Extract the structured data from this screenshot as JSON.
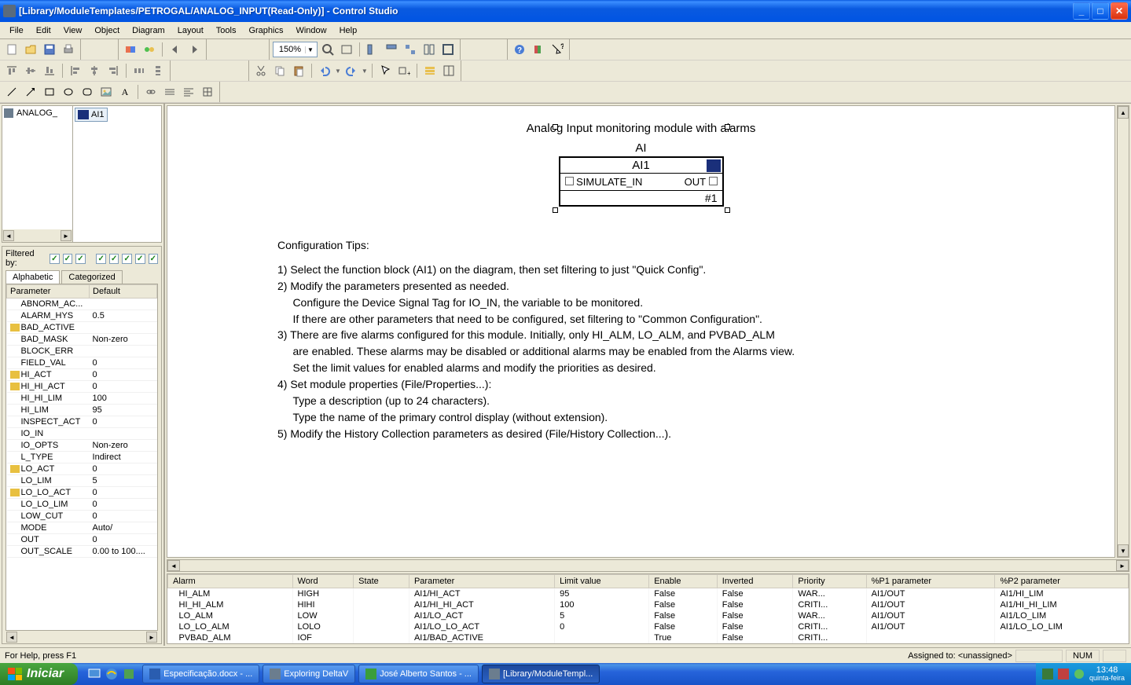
{
  "window": {
    "title": "[Library/ModuleTemplates/PETROGAL/ANALOG_INPUT(Read-Only)] - Control Studio"
  },
  "menu": [
    "File",
    "Edit",
    "View",
    "Object",
    "Diagram",
    "Layout",
    "Tools",
    "Graphics",
    "Window",
    "Help"
  ],
  "zoom": "150%",
  "hierarchy": {
    "root": "ANALOG_",
    "block": "AI1"
  },
  "filter_label": "Filtered by:",
  "param_tabs": {
    "active": "Alphabetic",
    "other": "Categorized"
  },
  "param_headers": {
    "name": "Parameter",
    "default": "Default"
  },
  "params": [
    {
      "name": "ABNORM_AC...",
      "def": ""
    },
    {
      "name": "ALARM_HYS",
      "def": "0.5"
    },
    {
      "name": "BAD_ACTIVE",
      "def": "",
      "ico": true
    },
    {
      "name": "BAD_MASK",
      "def": "Non-zero"
    },
    {
      "name": "BLOCK_ERR",
      "def": ""
    },
    {
      "name": "FIELD_VAL",
      "def": "0"
    },
    {
      "name": "HI_ACT",
      "def": "0",
      "ico": true
    },
    {
      "name": "HI_HI_ACT",
      "def": "0",
      "ico": true
    },
    {
      "name": "HI_HI_LIM",
      "def": "100"
    },
    {
      "name": "HI_LIM",
      "def": "95"
    },
    {
      "name": "INSPECT_ACT",
      "def": "0"
    },
    {
      "name": "IO_IN",
      "def": ""
    },
    {
      "name": "IO_OPTS",
      "def": "Non-zero"
    },
    {
      "name": "L_TYPE",
      "def": "Indirect"
    },
    {
      "name": "LO_ACT",
      "def": "0",
      "ico": true
    },
    {
      "name": "LO_LIM",
      "def": "5"
    },
    {
      "name": "LO_LO_ACT",
      "def": "0",
      "ico": true
    },
    {
      "name": "LO_LO_LIM",
      "def": "0"
    },
    {
      "name": "LOW_CUT",
      "def": "0"
    },
    {
      "name": "MODE",
      "def": "Auto/"
    },
    {
      "name": "OUT",
      "def": "0"
    },
    {
      "name": "OUT_SCALE",
      "def": "0.00 to 100...."
    }
  ],
  "diagram": {
    "title": "Analog Input monitoring module with alarms",
    "block": {
      "type": "AI",
      "name": "AI1",
      "in": "SIMULATE_IN",
      "out": "OUT",
      "idx": "#1"
    },
    "tips_heading": "Configuration Tips:",
    "tips": [
      "1)  Select the function block (AI1) on the diagram, then set filtering to just \"Quick Config\".",
      "2)  Modify the parameters presented as needed.",
      "     Configure the Device Signal Tag for IO_IN, the variable to be monitored.",
      "     If there are other parameters that need to be configured, set filtering to \"Common Configuration\".",
      "3)  There are five alarms configured for this module.  Initially, only HI_ALM, LO_ALM, and PVBAD_ALM",
      "     are enabled.  These alarms may be disabled or additional alarms may be enabled from the Alarms view.",
      "     Set the limit values for enabled alarms and modify the priorities as desired.",
      "4)  Set module properties (File/Properties...):",
      "     Type a description (up to 24 characters).",
      "     Type the name of the primary control display (without extension).",
      "5)  Modify the History Collection parameters as desired (File/History Collection...)."
    ]
  },
  "alarm_headers": [
    "Alarm",
    "Word",
    "State",
    "Parameter",
    "Limit value",
    "Enable",
    "Inverted",
    "Priority",
    "%P1 parameter",
    "%P2 parameter"
  ],
  "alarms": [
    {
      "a": "HI_ALM",
      "w": "HIGH",
      "s": "",
      "p": "AI1/HI_ACT",
      "lv": "95",
      "en": "False",
      "inv": "False",
      "pr": "WAR...",
      "p1": "AI1/OUT",
      "p2": "AI1/HI_LIM"
    },
    {
      "a": "HI_HI_ALM",
      "w": "HIHI",
      "s": "",
      "p": "AI1/HI_HI_ACT",
      "lv": "100",
      "en": "False",
      "inv": "False",
      "pr": "CRITI...",
      "p1": "AI1/OUT",
      "p2": "AI1/HI_HI_LIM"
    },
    {
      "a": "LO_ALM",
      "w": "LOW",
      "s": "",
      "p": "AI1/LO_ACT",
      "lv": "5",
      "en": "False",
      "inv": "False",
      "pr": "WAR...",
      "p1": "AI1/OUT",
      "p2": "AI1/LO_LIM"
    },
    {
      "a": "LO_LO_ALM",
      "w": "LOLO",
      "s": "",
      "p": "AI1/LO_LO_ACT",
      "lv": "0",
      "en": "False",
      "inv": "False",
      "pr": "CRITI...",
      "p1": "AI1/OUT",
      "p2": "AI1/LO_LO_LIM"
    },
    {
      "a": "PVBAD_ALM",
      "w": "IOF",
      "s": "",
      "p": "AI1/BAD_ACTIVE",
      "lv": "",
      "en": "True",
      "inv": "False",
      "pr": "CRITI...",
      "p1": "",
      "p2": ""
    }
  ],
  "status": {
    "help": "For Help, press F1",
    "assigned_label": "Assigned to:",
    "assigned": "<unassigned>",
    "num": "NUM"
  },
  "taskbar": {
    "start": "Iniciar",
    "tasks": [
      {
        "label": "Especificação.docx - ...",
        "ico": "#2a5db0"
      },
      {
        "label": "Exploring DeltaV",
        "ico": "#6b7d8e"
      },
      {
        "label": "José Alberto Santos - ...",
        "ico": "#3a9e3a"
      },
      {
        "label": "[Library/ModuleTempl...",
        "ico": "#6b7d8e",
        "active": true
      }
    ],
    "clock": {
      "time": "13:48",
      "date": "quinta-feira"
    }
  }
}
